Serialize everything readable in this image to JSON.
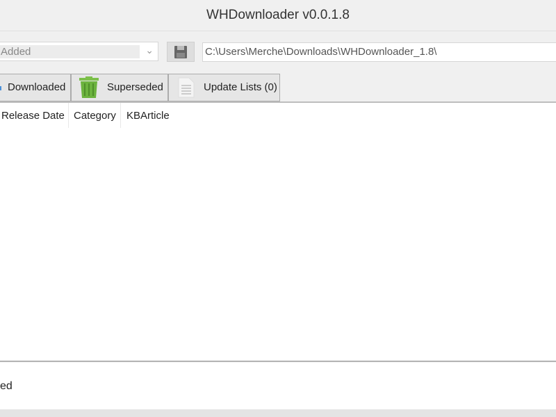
{
  "window": {
    "title": "WHDownloader v0.0.1.8"
  },
  "toolbar": {
    "filter_value": "Added",
    "save_icon": "floppy-disk-icon",
    "path_value": "C:\\Users\\Merche\\Downloads\\WHDownloader_1.8\\"
  },
  "tabs": [
    {
      "label": "Downloaded"
    },
    {
      "label": "Superseded",
      "icon": "trash-icon"
    },
    {
      "label": "Update Lists (0)",
      "icon": "document-icon"
    }
  ],
  "list": {
    "columns": [
      "Release Date",
      "Category",
      "KBArticle"
    ]
  },
  "status": {
    "text": "ed"
  },
  "colors": {
    "superseded_icon": "#6cb33e"
  }
}
